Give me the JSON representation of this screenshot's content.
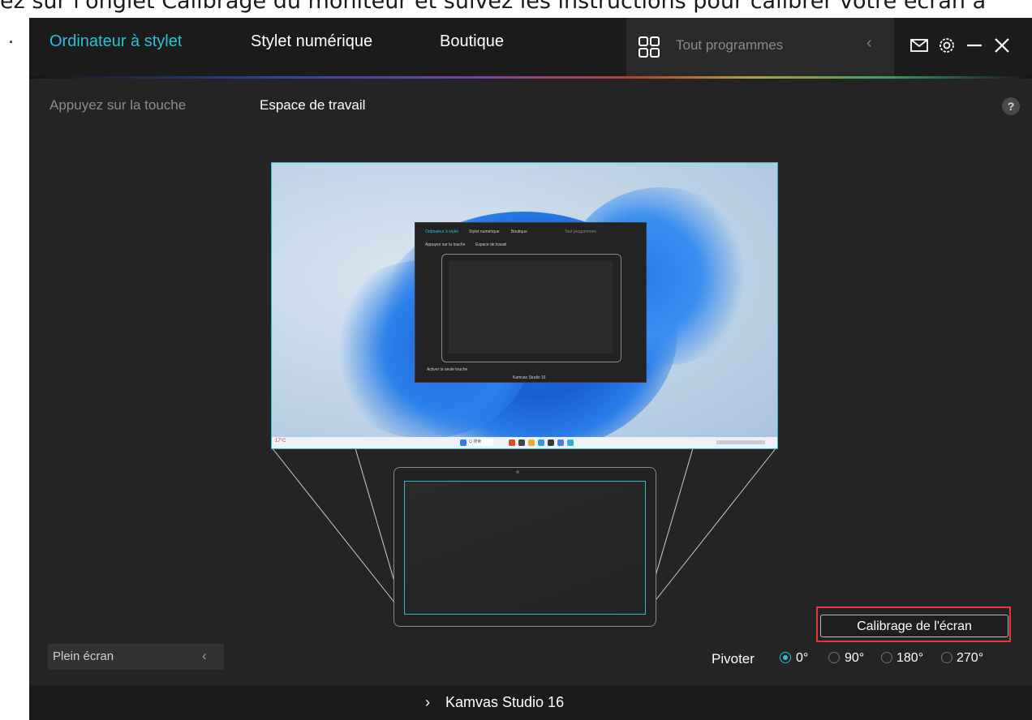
{
  "caption": {
    "text": "ez sur l'onglet Calibrage du moniteur et suivez les instructions pour calibrer votre écran a",
    "bullet": "."
  },
  "header": {
    "tabs": [
      {
        "label": "Ordinateur à stylet",
        "active": true
      },
      {
        "label": "Stylet numérique",
        "active": false
      },
      {
        "label": "Boutique",
        "active": false
      }
    ],
    "search": {
      "placeholder": "Tout programmes",
      "icon": "grid-icon",
      "back_icon": "chevron-left-icon"
    },
    "window_icons": [
      "mail-icon",
      "gear-icon",
      "minimize-icon",
      "close-icon"
    ]
  },
  "subtabs": [
    {
      "label": "Appuyez sur la touche",
      "active": false
    },
    {
      "label": "Espace de travail",
      "active": true
    }
  ],
  "help_icon": "?",
  "preview": {
    "mini_tabs": [
      "Ordinateur à stylet",
      "Stylet numérique",
      "Boutique"
    ],
    "mini_search": "Tout programmes",
    "mini_subtabs": [
      "Appuyez sur la touche",
      "Espace de travail"
    ],
    "mini_checkbox": "Activer la seule touche",
    "mini_device": "Kamvas Studio 16",
    "weather_temp": "17°C",
    "taskbar_search": "Q 搜索"
  },
  "calibration_button": "Calibrage de l'écran",
  "rotation": {
    "label": "Pivoter",
    "options": [
      "0°",
      "90°",
      "180°",
      "270°"
    ],
    "selected": "0°"
  },
  "display_mode": {
    "value": "Plein écran"
  },
  "footer": {
    "device": "Kamvas Studio 16"
  },
  "colors": {
    "accent": "#2bc1d9",
    "highlight": "#e03a3a",
    "background": "#242424"
  }
}
